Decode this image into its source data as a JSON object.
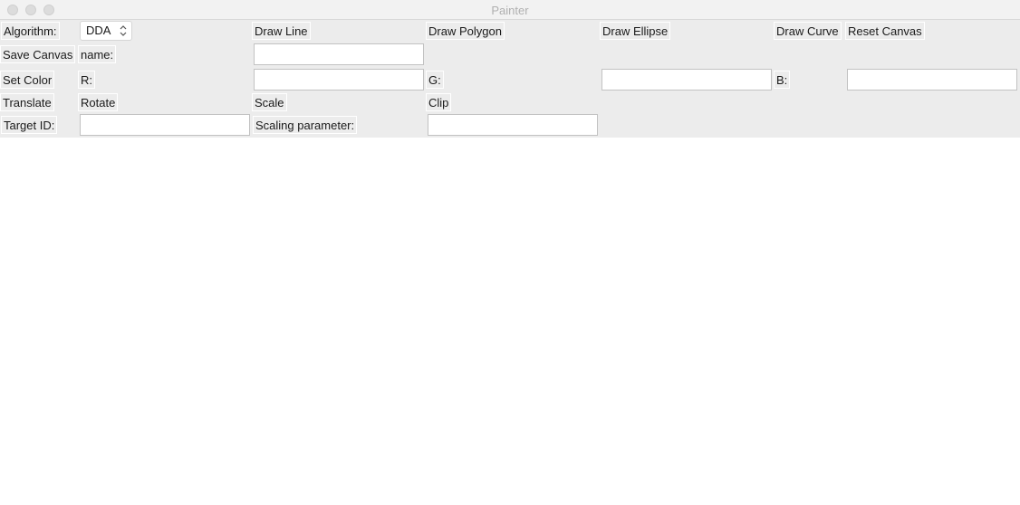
{
  "window": {
    "title": "Painter"
  },
  "toolbar": {
    "algorithm_label": "Algorithm:",
    "algorithm_value": "DDA",
    "draw_line": "Draw Line",
    "draw_polygon": "Draw Polygon",
    "draw_ellipse": "Draw Ellipse",
    "draw_curve": "Draw Curve",
    "reset_canvas": "Reset Canvas",
    "save_canvas": "Save Canvas",
    "name_label": "name:",
    "name_value": "",
    "set_color": "Set Color",
    "r_label": "R:",
    "r_value": "",
    "g_label": "G:",
    "g_value": "",
    "b_label": "B:",
    "b_value": "",
    "translate": "Translate",
    "rotate": "Rotate",
    "scale": "Scale",
    "clip": "Clip",
    "target_id_label": "Target ID:",
    "target_id_value": "",
    "scaling_label": "Scaling parameter:",
    "scaling_value": ""
  }
}
